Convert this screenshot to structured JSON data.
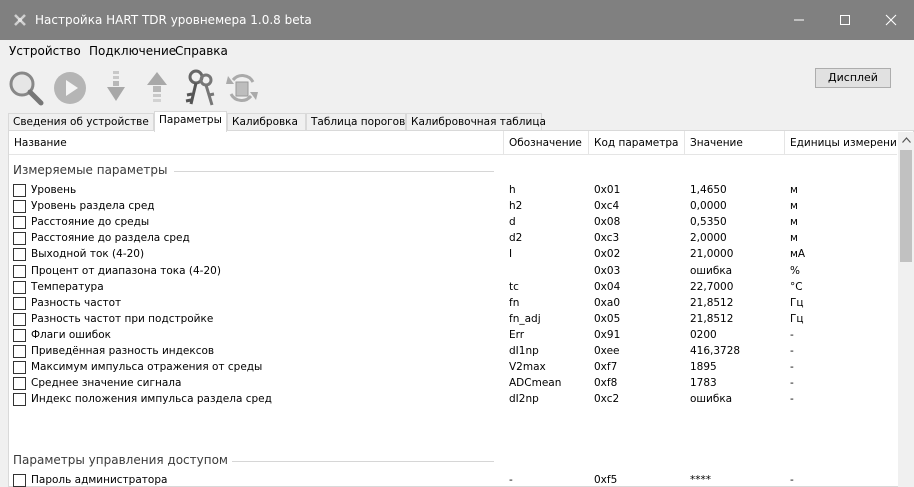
{
  "window": {
    "title": "Настройка HART TDR уровнемера 1.0.8 beta",
    "controls": [
      "minimize-icon",
      "maximize-icon",
      "close-icon"
    ]
  },
  "menu": {
    "items": [
      "Устройство",
      "Подключение",
      "Справка"
    ]
  },
  "toolbar": {
    "icons": [
      "search-icon",
      "play-icon",
      "download-icon",
      "upload-icon",
      "key-icon",
      "sync-icon"
    ],
    "display_button": "Дисплей"
  },
  "tabs": {
    "items": [
      "Сведения об устройстве",
      "Параметры",
      "Калибровка",
      "Таблица порогов",
      "Калибровочная таблица"
    ],
    "active": "Параметры"
  },
  "table": {
    "columns": [
      "Название",
      "Обозначение",
      "Код параметра",
      "Значение",
      "Единицы измерения"
    ],
    "groups": [
      {
        "title": "Измеряемые параметры",
        "rows": [
          {
            "name": "Уровень",
            "symbol": "h",
            "code": "0x01",
            "value": "1,4650",
            "unit": "м"
          },
          {
            "name": "Уровень раздела сред",
            "symbol": "h2",
            "code": "0xc4",
            "value": "0,0000",
            "unit": "м"
          },
          {
            "name": "Расстояние до среды",
            "symbol": "d",
            "code": "0x08",
            "value": "0,5350",
            "unit": "м"
          },
          {
            "name": "Расстояние до раздела сред",
            "symbol": "d2",
            "code": "0xc3",
            "value": "2,0000",
            "unit": "м"
          },
          {
            "name": "Выходной ток (4-20)",
            "symbol": "I",
            "code": "0x02",
            "value": "21,0000",
            "unit": "мА"
          },
          {
            "name": "Процент от диапазона тока (4-20)",
            "symbol": "",
            "code": "0x03",
            "value": "ошибка",
            "unit": "%"
          },
          {
            "name": "Температура",
            "symbol": "tc",
            "code": "0x04",
            "value": "22,7000",
            "unit": "°C"
          },
          {
            "name": "Разность частот",
            "symbol": "fn",
            "code": "0xa0",
            "value": "21,8512",
            "unit": "Гц"
          },
          {
            "name": "Разность частот при подстройке",
            "symbol": "fn_adj",
            "code": "0x05",
            "value": "21,8512",
            "unit": "Гц"
          },
          {
            "name": "Флаги ошибок",
            "symbol": "Err",
            "code": "0x91",
            "value": "0200",
            "unit": "-"
          },
          {
            "name": "Приведённая разность индексов",
            "symbol": "dI1np",
            "code": "0xee",
            "value": "416,3728",
            "unit": "-"
          },
          {
            "name": "Максимум импульса отражения от среды",
            "symbol": "V2max",
            "code": "0xf7",
            "value": "1895",
            "unit": "-"
          },
          {
            "name": "Среднее значение сигнала",
            "symbol": "ADCmean",
            "code": "0xf8",
            "value": "1783",
            "unit": "-"
          },
          {
            "name": "Индекс положения импульса раздела сред",
            "symbol": "dI2np",
            "code": "0xc2",
            "value": "ошибка",
            "unit": "-"
          }
        ]
      },
      {
        "title": "Параметры управления доступом",
        "rows": [
          {
            "name": "Пароль администратора",
            "symbol": "-",
            "code": "0xf5",
            "value": "****",
            "unit": "-"
          }
        ]
      }
    ]
  }
}
